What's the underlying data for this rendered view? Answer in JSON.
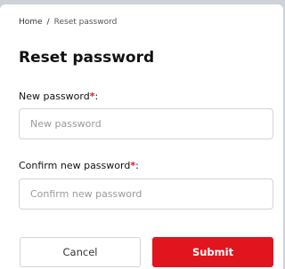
{
  "breadcrumb": {
    "home": "Home",
    "separator": "/",
    "current": "Reset password"
  },
  "page": {
    "title": "Reset password"
  },
  "form": {
    "new_password": {
      "label": "New password",
      "required_mark": "*",
      "suffix": ":",
      "placeholder": "New password",
      "value": ""
    },
    "confirm_password": {
      "label": "Confirm new password",
      "required_mark": "*",
      "suffix": ":",
      "placeholder": "Confirm new password",
      "value": ""
    }
  },
  "actions": {
    "cancel_label": "Cancel",
    "submit_label": "Submit"
  },
  "colors": {
    "accent": "#e0151d",
    "page_background": "#cfd3d7",
    "card_background": "#ffffff",
    "border": "#d4d4d4"
  }
}
